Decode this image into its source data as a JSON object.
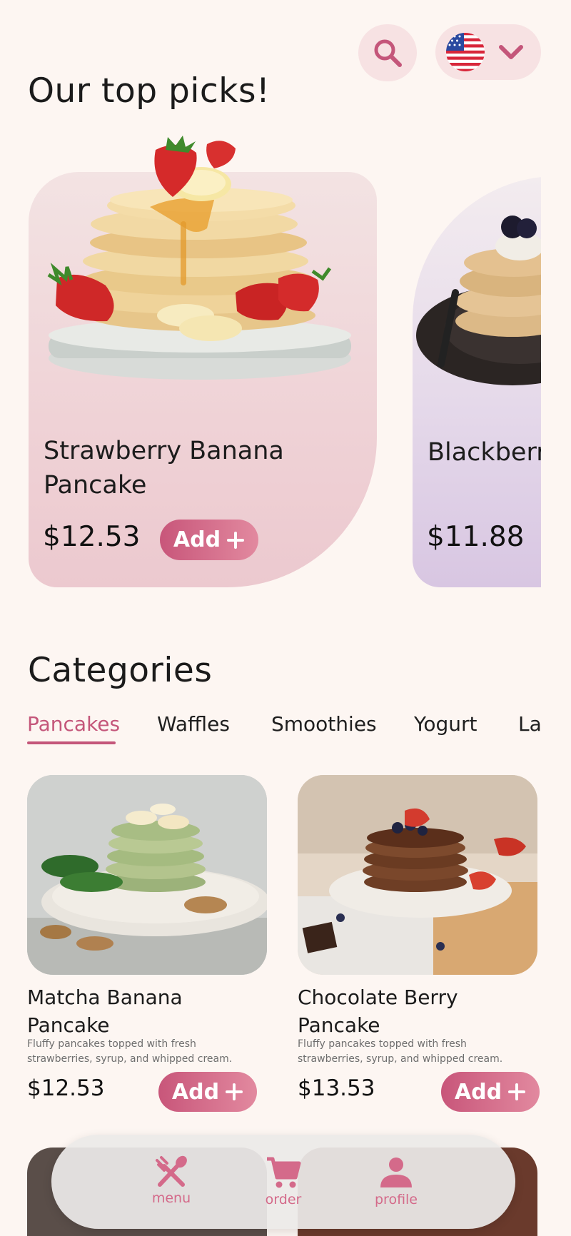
{
  "header": {
    "title": "Our top picks!",
    "search_icon": "search-icon",
    "language_icon": "us-flag-icon",
    "dropdown_icon": "chevron-down-icon"
  },
  "top_picks": [
    {
      "name_line1": "Strawberry Banana",
      "name_line2": "Pancake",
      "price": "$12.53",
      "add_label": "Add"
    },
    {
      "name_line1": "Blackberr",
      "name_line2": "",
      "price": "$11.88"
    }
  ],
  "categories": {
    "title": "Categories",
    "tabs": [
      "Pancakes",
      "Waffles",
      "Smoothies",
      "Yogurt",
      "La"
    ],
    "active_tab": "Pancakes"
  },
  "items": [
    {
      "name_line1": "Matcha Banana",
      "name_line2": "Pancake",
      "desc_line1": "Fluffy pancakes topped with fresh",
      "desc_line2": "strawberries, syrup, and whipped cream.",
      "price": "$12.53",
      "add_label": "Add"
    },
    {
      "name_line1": "Chocolate Berry",
      "name_line2": "Pancake",
      "desc_line1": "Fluffy pancakes topped with fresh",
      "desc_line2": "strawberries, syrup, and whipped cream.",
      "price": "$13.53",
      "add_label": "Add"
    }
  ],
  "nav": [
    {
      "label": "menu",
      "icon": "fork-spoon-icon"
    },
    {
      "label": "order",
      "icon": "cart-icon"
    },
    {
      "label": "profile",
      "icon": "person-icon"
    }
  ],
  "colors": {
    "background": "#fdf6f2",
    "accent": "#c4567a",
    "accent_light": "#f7e2e3"
  }
}
